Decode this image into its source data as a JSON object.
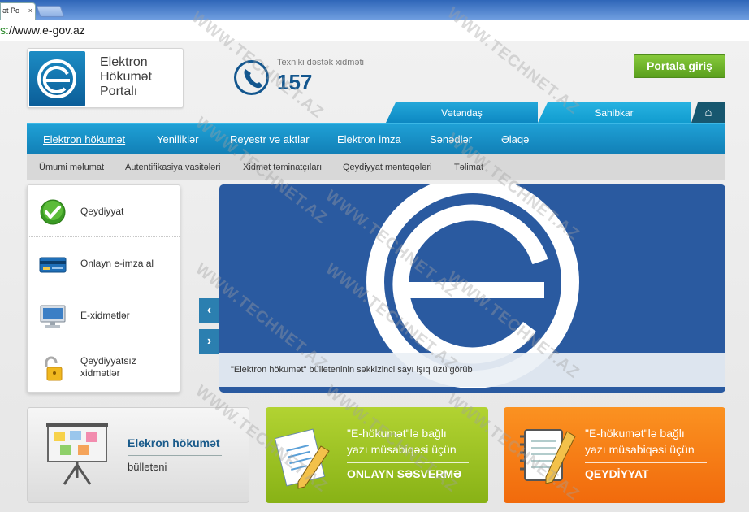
{
  "browser": {
    "tab_title": "ət Po",
    "tab_close": "×",
    "url_scheme": "s:",
    "url_rest": "//www.e-gov.az"
  },
  "header": {
    "logo_lines": [
      "Elektron",
      "Hökumət",
      "Portalı"
    ],
    "support_label": "Texniki dəstək xidməti",
    "support_number": "157",
    "portal_button": "Portala giriş"
  },
  "role_tabs": {
    "citizen": "Vətəndaş",
    "business": "Sahibkar",
    "home_icon": "⌂"
  },
  "main_nav": [
    "Elektron hökumət",
    "Yeniliklər",
    "Reyestr və aktlar",
    "Elektron imza",
    "Sənədlər",
    "Əlaqə"
  ],
  "sub_nav": [
    "Ümumi məlumat",
    "Autentifikasiya vasitələri",
    "Xidmət təminatçıları",
    "Qeydiyyat məntəqələri",
    "Təlimat"
  ],
  "side_menu": [
    {
      "label": "Qeydiyyat",
      "icon": "checkmark-icon"
    },
    {
      "label": "Onlayn e-imza al",
      "icon": "card-icon"
    },
    {
      "label": "E-xidmətlər",
      "icon": "monitor-icon"
    },
    {
      "label": "Qeydiyyatsız xidmətlər",
      "icon": "unlock-icon"
    }
  ],
  "slider": {
    "caption": "\"Elektron hökumət\" bülleteninin səkkizinci sayı işıq üzü görüb",
    "prev": "‹",
    "next": "›"
  },
  "banners": {
    "bulletin_title": "Elekron hökumət",
    "bulletin_sub": "bülleteni",
    "vote_line1": "\"E-hökumət\"lə bağlı",
    "vote_line2": "yazı müsabiqəsi üçün",
    "vote_action": "ONLAYN SƏSVERMƏ",
    "reg_line1": "\"E-hökumət\"lə bağlı",
    "reg_line2": "yazı müsabiqəsi üçün",
    "reg_action": "QEYDİYYAT"
  },
  "watermark": "WWW.TECHNET.AZ",
  "colors": {
    "primary_blue": "#1583bd",
    "light_blue": "#22a6d9",
    "green": "#6fb42a",
    "orange": "#f57a14",
    "slider_blue": "#2a5aa0"
  }
}
